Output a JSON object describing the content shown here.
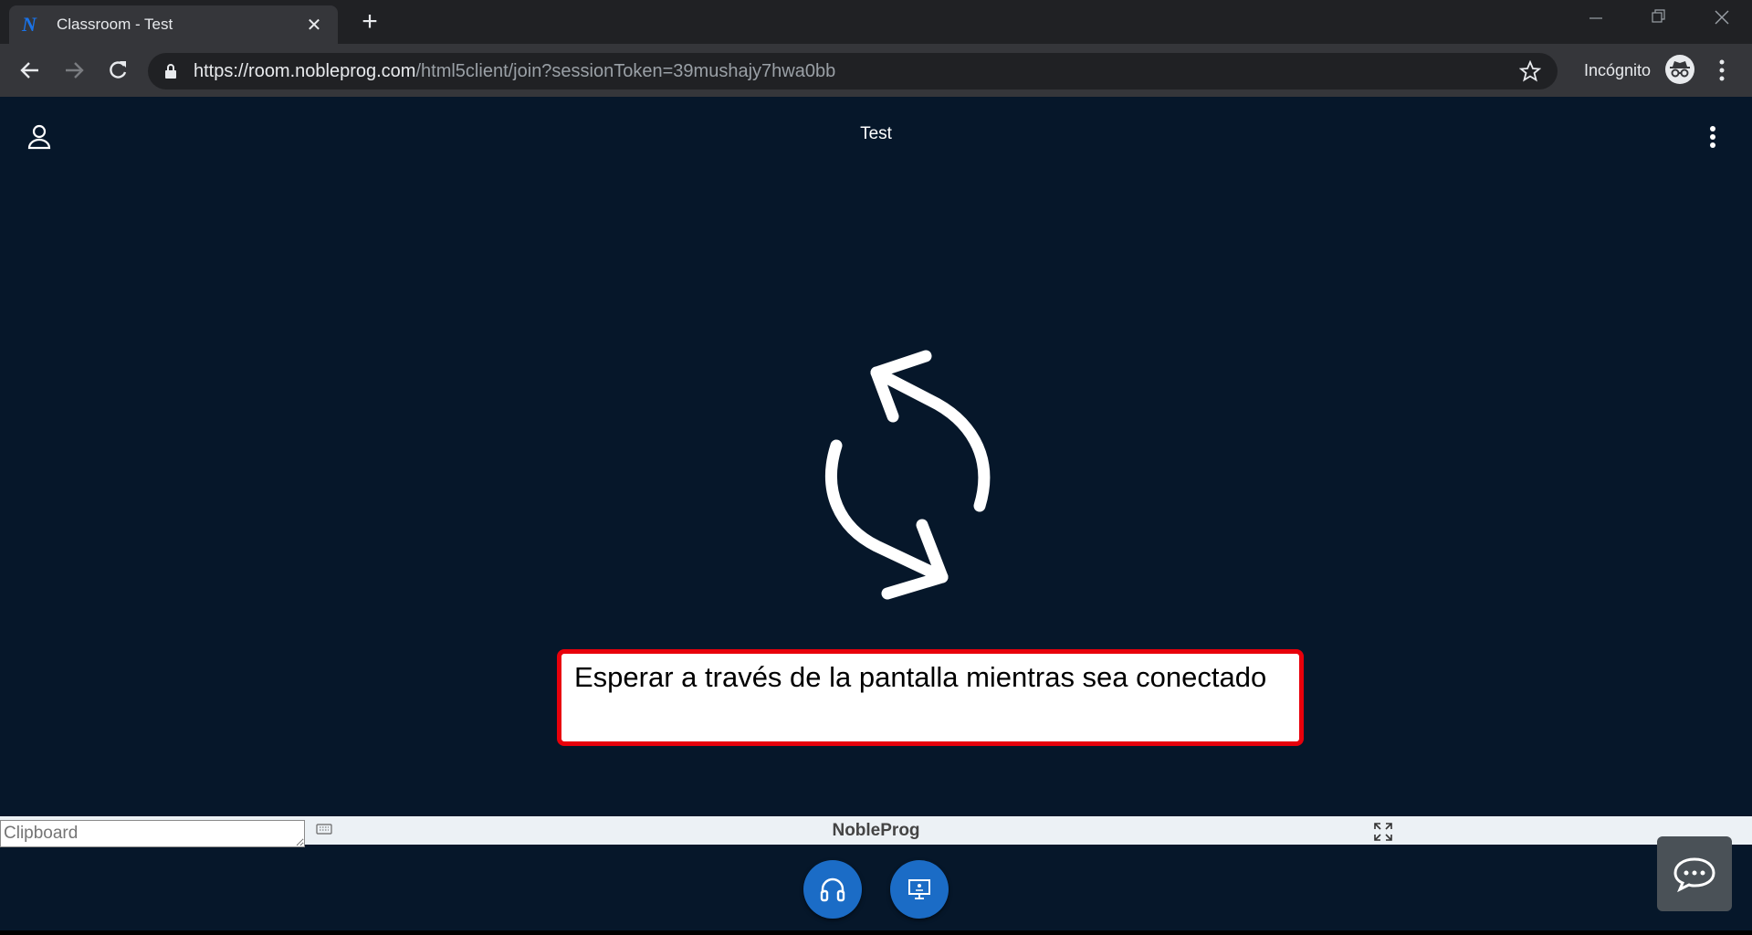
{
  "browser": {
    "tab_favicon": "N",
    "tab_title": "Classroom - Test",
    "tab_close": "✕",
    "new_tab": "+",
    "url_host": "https://room.nobleprog.com",
    "url_path": "/html5client/join?sessionToken=39mushajy7hwa0bb",
    "incognito_label": "Incógnito"
  },
  "app": {
    "room_title": "Test",
    "notice_text": "Esperar a través de la pantalla mientras sea conectado",
    "clipboard_placeholder": "Clipboard",
    "brand": "NobleProg"
  },
  "colors": {
    "background": "#06172a",
    "accent_button": "#1b6cc6",
    "notice_border": "#e8000b"
  }
}
